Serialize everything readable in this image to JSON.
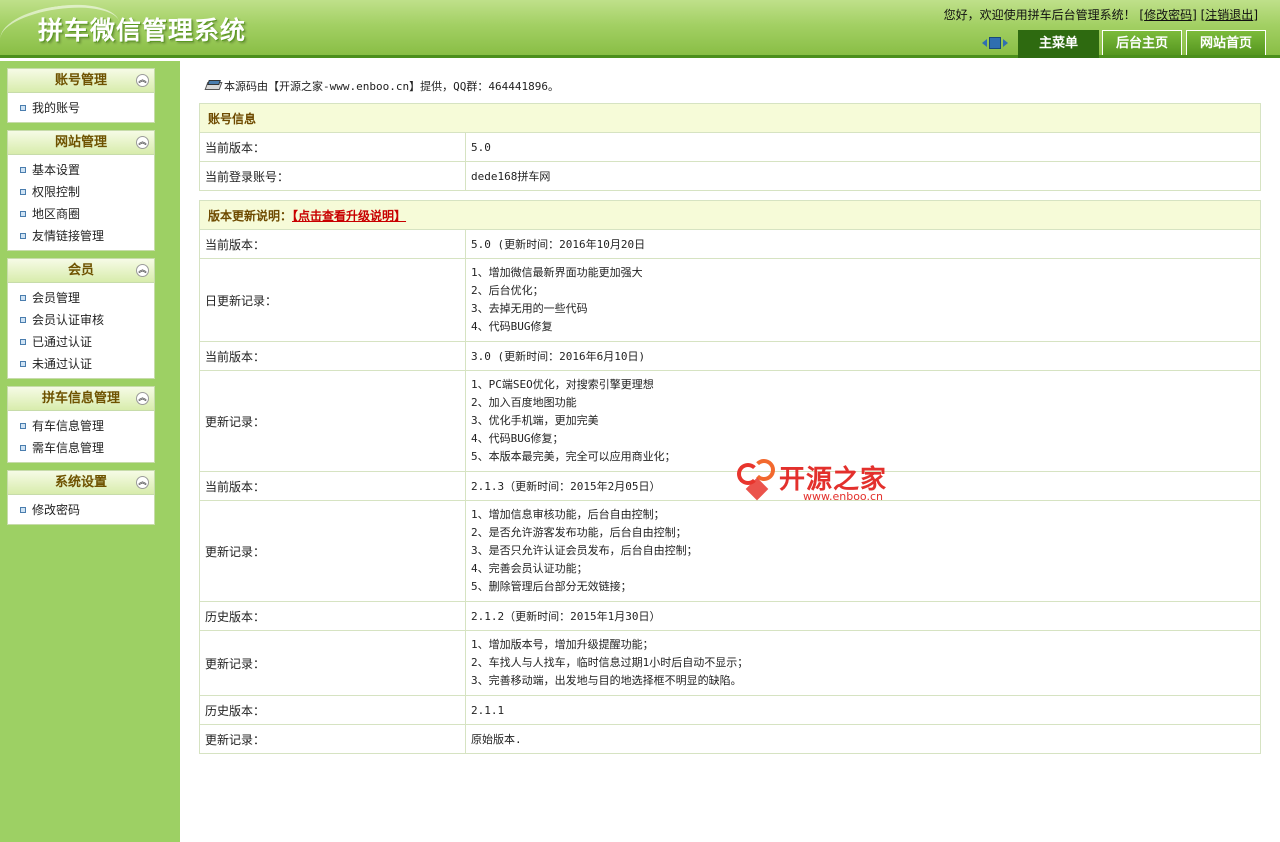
{
  "header": {
    "logo_text": "拼车微信管理系统",
    "welcome_prefix": "您好，欢迎使用拼车后台管理系统！ [",
    "change_password_link": "修改密码",
    "separator": "] [",
    "logout_link": "注销退出",
    "welcome_suffix": "]",
    "tabs": [
      {
        "label": "主菜单",
        "active": true
      },
      {
        "label": "后台主页",
        "active": false
      },
      {
        "label": "网站首页",
        "active": false
      }
    ]
  },
  "sidebar": {
    "groups": [
      {
        "title": "账号管理",
        "items": [
          "我的账号"
        ]
      },
      {
        "title": "网站管理",
        "items": [
          "基本设置",
          "权限控制",
          "地区商圈",
          "友情链接管理"
        ]
      },
      {
        "title": "会员",
        "items": [
          "会员管理",
          "会员认证审核",
          "已通过认证",
          "未通过认证"
        ]
      },
      {
        "title": "拼车信息管理",
        "items": [
          "有车信息管理",
          "需车信息管理"
        ]
      },
      {
        "title": "系统设置",
        "items": [
          "修改密码"
        ]
      }
    ]
  },
  "main": {
    "source_note": "本源码由【开源之家-www.enboo.cn】提供，QQ群：464441896。",
    "account": {
      "heading": "账号信息",
      "rows": [
        {
          "label": "当前版本：",
          "value": "5.0"
        },
        {
          "label": "当前登录账号：",
          "value": "dede168拼车网"
        }
      ]
    },
    "updates": {
      "heading": "版本更新说明：",
      "upgrade_link": "【点击查看升级说明】",
      "rows": [
        {
          "label": "当前版本：",
          "lines": [
            "5.0 (更新时间：2016年10月20日"
          ]
        },
        {
          "label": "日更新记录：",
          "lines": [
            "1、增加微信最新界面功能更加强大",
            "2、后台优化；",
            "3、去掉无用的一些代码",
            "4、代码BUG修复"
          ]
        },
        {
          "label": "当前版本：",
          "lines": [
            "3.0 (更新时间：2016年6月10日)"
          ]
        },
        {
          "label": "更新记录：",
          "lines": [
            "1、PC端SEO优化，对搜索引擎更理想",
            "2、加入百度地图功能",
            "3、优化手机端，更加完美",
            "4、代码BUG修复；",
            "5、本版本最完美，完全可以应用商业化；"
          ]
        },
        {
          "label": "当前版本：",
          "lines": [
            "2.1.3（更新时间：2015年2月05日）"
          ]
        },
        {
          "label": "更新记录：",
          "lines": [
            "1、增加信息审核功能，后台自由控制；",
            "2、是否允许游客发布功能，后台自由控制；",
            "3、是否只允许认证会员发布，后台自由控制；",
            "4、完善会员认证功能；",
            "5、删除管理后台部分无效链接；"
          ]
        },
        {
          "label": "历史版本：",
          "lines": [
            "2.1.2（更新时间：2015年1月30日）"
          ]
        },
        {
          "label": "更新记录：",
          "lines": [
            "1、增加版本号，增加升级提醒功能；",
            "2、车找人与人找车，临时信息过期1小时后自动不显示；",
            "3、完善移动端，出发地与目的地选择框不明显的缺陷。"
          ]
        },
        {
          "label": "历史版本：",
          "lines": [
            "2.1.1"
          ]
        },
        {
          "label": "更新记录：",
          "lines": [
            "原始版本."
          ]
        }
      ]
    },
    "watermark": {
      "text": "开源之家",
      "url": "www.enboo.cn"
    }
  }
}
